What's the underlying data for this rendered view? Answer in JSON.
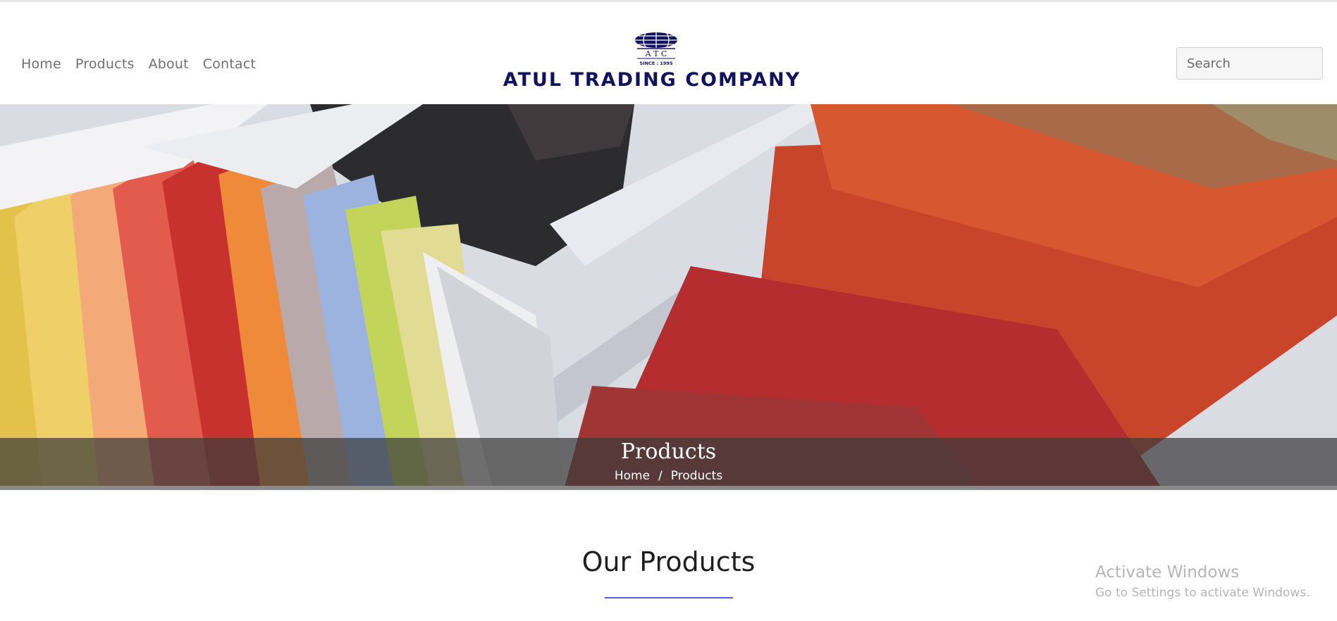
{
  "nav": {
    "items": [
      {
        "label": "Home"
      },
      {
        "label": "Products"
      },
      {
        "label": "About"
      },
      {
        "label": "Contact"
      }
    ]
  },
  "logo": {
    "initials": "A T C",
    "since": "SINCE : 1995",
    "company_name": "ATUL TRADING COMPANY"
  },
  "search": {
    "placeholder": "Search",
    "value": ""
  },
  "hero": {
    "title": "Products",
    "breadcrumb": [
      {
        "label": "Home"
      },
      {
        "label": "Products"
      }
    ],
    "breadcrumb_separator": "/"
  },
  "section": {
    "title": "Our Products"
  },
  "watermark": {
    "title": "Activate Windows",
    "subtitle": "Go to Settings to activate Windows."
  },
  "colors": {
    "logo_navy": "#12125e",
    "accent_underline": "#5a5ae0",
    "nav_text": "#6f6f6f"
  }
}
